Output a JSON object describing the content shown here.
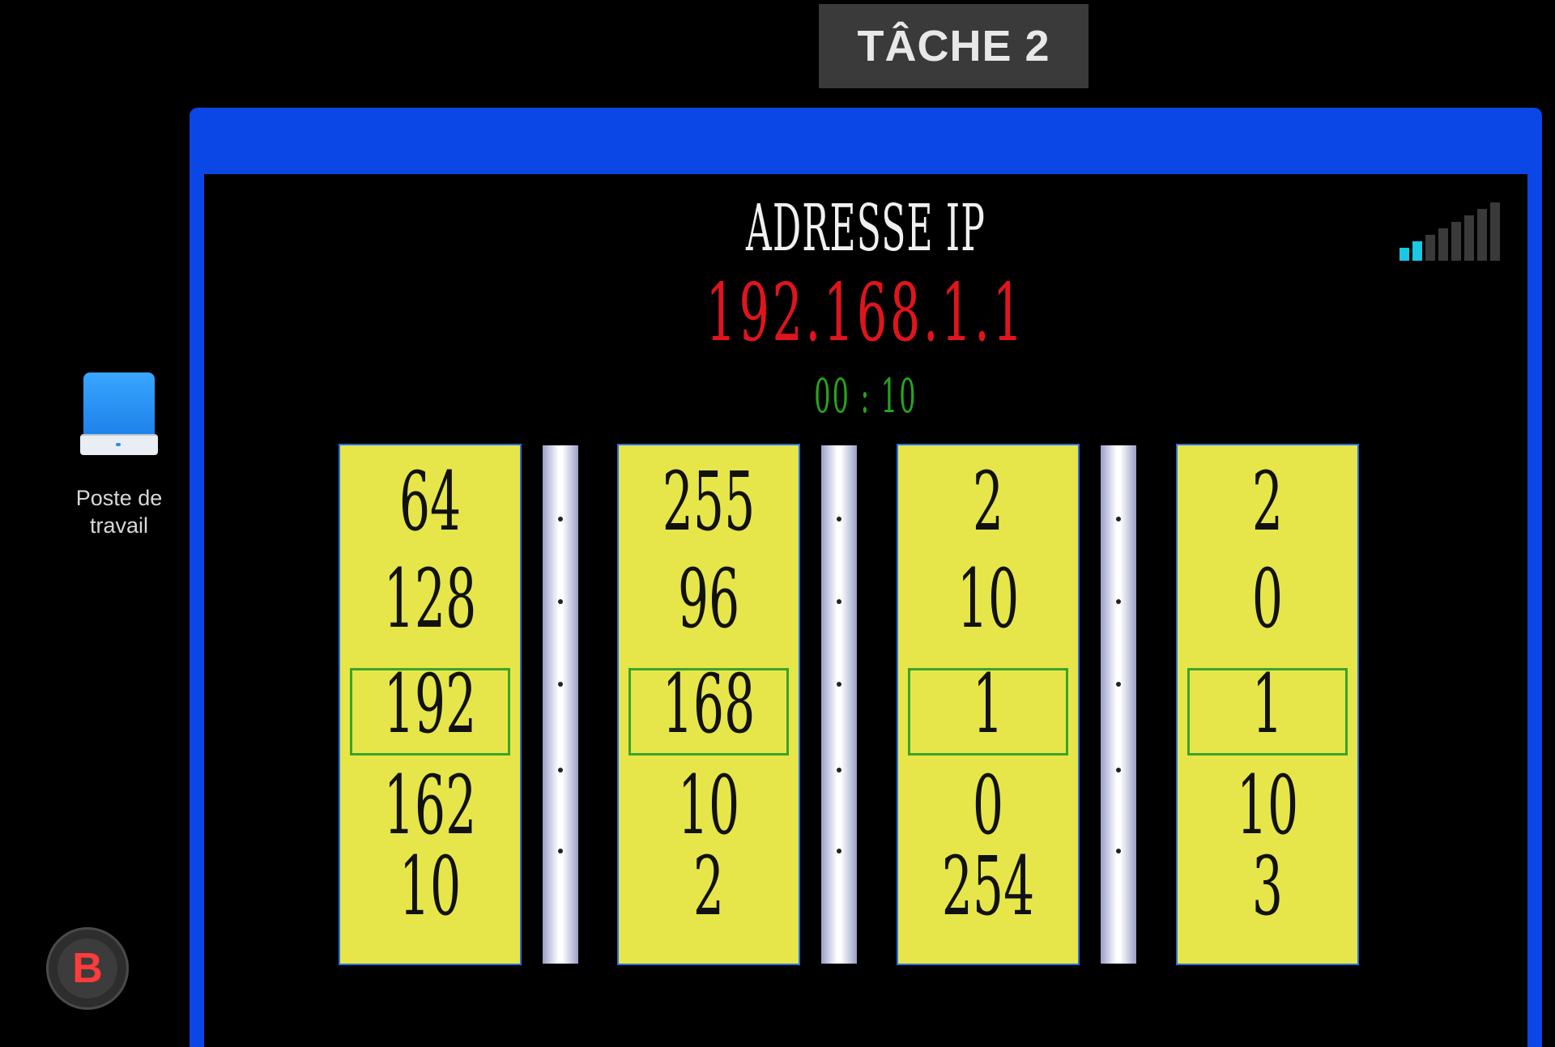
{
  "task_tab": {
    "label": "TÂCHE 2"
  },
  "desktop": {
    "icon_label": "Poste de travail",
    "badge": "B"
  },
  "window": {
    "title": "ADRESSE IP",
    "target_ip": "192.168.1.1",
    "timer": "00 : 10",
    "signal": {
      "level": 2,
      "of": 8,
      "color_on": "#18c8e4"
    },
    "columns": [
      {
        "values": [
          "64",
          "128",
          "192",
          "162",
          "10"
        ],
        "selected": "192"
      },
      {
        "values": [
          "255",
          "96",
          "168",
          "10",
          "2"
        ],
        "selected": "168"
      },
      {
        "values": [
          "2",
          "10",
          "1",
          "0",
          "254"
        ],
        "selected": "1"
      },
      {
        "values": [
          "2",
          "0",
          "1",
          "10",
          "3"
        ],
        "selected": "1"
      }
    ]
  },
  "colors": {
    "window_frame": "#0b47e6",
    "column_bg": "#e6e64a",
    "ip_text": "#e0141c",
    "timer_text": "#27a31f",
    "selection": "#3aa32a"
  }
}
